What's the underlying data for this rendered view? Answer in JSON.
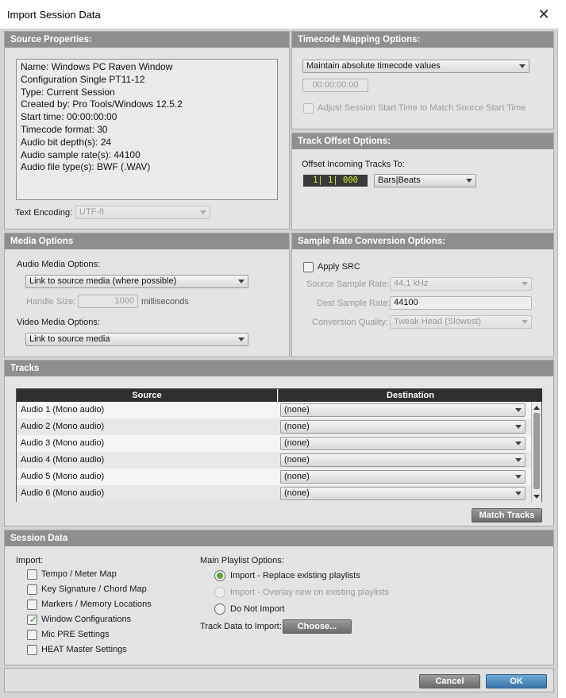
{
  "window": {
    "title": "Import Session Data",
    "close_glyph": "✕"
  },
  "source_properties": {
    "header": "Source Properties:",
    "lines": [
      "Name: Windows PC Raven Window",
      "Configuration Single PT11-12",
      "Type: Current Session",
      "Created by: Pro Tools/Windows 12.5.2",
      "Start time: 00:00:00:00",
      "Timecode format: 30",
      "Audio bit depth(s): 24",
      "Audio sample rate(s): 44100",
      "Audio file type(s): BWF (.WAV)"
    ],
    "text_encoding_label": "Text Encoding:",
    "text_encoding_value": "UTF-8"
  },
  "timecode_mapping": {
    "header": "Timecode Mapping Options:",
    "mode": "Maintain absolute timecode values",
    "timecode": "00:00:00:00",
    "adjust_label": "Adjust Session Start Time to Match Source Start Time"
  },
  "track_offset": {
    "header": "Track Offset Options:",
    "label": "Offset Incoming Tracks To:",
    "value": "1| 1| 000",
    "units": "Bars|Beats"
  },
  "media_options": {
    "header": "Media Options",
    "audio_label": "Audio Media Options:",
    "audio_value": "Link to source media (where possible)",
    "handle_label": "Handle Size:",
    "handle_value": "1000",
    "handle_units": "milliseconds",
    "video_label": "Video Media Options:",
    "video_value": "Link to source media"
  },
  "src": {
    "header": "Sample Rate Conversion Options:",
    "apply_label": "Apply SRC",
    "source_rate_label": "Source Sample Rate:",
    "source_rate_value": "44.1 kHz",
    "dest_rate_label": "Dest Sample Rate:",
    "dest_rate_value": "44100",
    "quality_label": "Conversion Quality:",
    "quality_value": "Tweak Head (Slowest)"
  },
  "tracks": {
    "header": "Tracks",
    "col_source": "Source",
    "col_destination": "Destination",
    "rows": [
      {
        "source": "Audio 1 (Mono audio)",
        "destination": "(none)"
      },
      {
        "source": "Audio 2 (Mono audio)",
        "destination": "(none)"
      },
      {
        "source": "Audio 3 (Mono audio)",
        "destination": "(none)"
      },
      {
        "source": "Audio 4 (Mono audio)",
        "destination": "(none)"
      },
      {
        "source": "Audio 5 (Mono audio)",
        "destination": "(none)"
      },
      {
        "source": "Audio 6 (Mono audio)",
        "destination": "(none)"
      }
    ],
    "match_button": "Match Tracks"
  },
  "session_data": {
    "header": "Session Data",
    "import_label": "Import:",
    "items": [
      {
        "label": "Tempo / Meter Map",
        "checked": false
      },
      {
        "label": "Key Signature / Chord Map",
        "checked": false
      },
      {
        "label": "Markers / Memory Locations",
        "checked": false
      },
      {
        "label": "Window Configurations",
        "checked": true
      },
      {
        "label": "Mic PRE Settings",
        "checked": false
      },
      {
        "label": "HEAT Master Settings",
        "checked": false
      }
    ],
    "playlist_label": "Main Playlist Options:",
    "playlist_options": [
      {
        "label": "Import - Replace existing playlists",
        "selected": true,
        "enabled": true
      },
      {
        "label": "Import - Overlay new on existing playlists",
        "selected": false,
        "enabled": false
      },
      {
        "label": "Do Not Import",
        "selected": false,
        "enabled": true
      }
    ],
    "track_data_label": "Track Data to Import:",
    "choose_button": "Choose..."
  },
  "footer": {
    "cancel": "Cancel",
    "ok": "OK"
  },
  "colors": {
    "accent_ok": "#3a74a8",
    "timecode_text": "#d8e836",
    "check_green": "#2f8a25",
    "radio_green": "#5aa832"
  },
  "icons": [
    "close-icon",
    "chevron-down-icon",
    "check-icon",
    "scroll-up-icon",
    "scroll-down-icon"
  ]
}
